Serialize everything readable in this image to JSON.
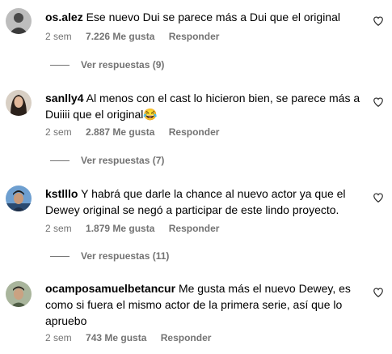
{
  "comments": [
    {
      "username": "os.alez",
      "text": "Ese nuevo Dui se parece más a Dui que el original",
      "time": "2 sem",
      "likes": "7.226 Me gusta",
      "reply": "Responder",
      "replies": "Ver respuestas (9)",
      "avatar_color": "#6b6b6b"
    },
    {
      "username": "sanlly4",
      "text": "Al menos con el cast lo hicieron bien, se parece más a Duiiii que el original😂",
      "time": "2 sem",
      "likes": "2.887 Me gusta",
      "reply": "Responder",
      "replies": "Ver respuestas (7)",
      "avatar_color": "#5a4a3e"
    },
    {
      "username": "kstlllo",
      "text": "Y habrá que darle la chance al nuevo actor ya que el Dewey original se negó a participar de este lindo proyecto.",
      "time": "2 sem",
      "likes": "1.879 Me gusta",
      "reply": "Responder",
      "replies": "Ver respuestas (11)",
      "avatar_color": "#3c6fa8"
    },
    {
      "username": "ocamposamuelbetancur",
      "text": "Me gusta más el nuevo Dewey, es como si fuera el mismo actor de la primera serie, así que lo apruebo",
      "time": "2 sem",
      "likes": "743 Me gusta",
      "reply": "Responder",
      "avatar_color": "#7a8b6f"
    }
  ]
}
